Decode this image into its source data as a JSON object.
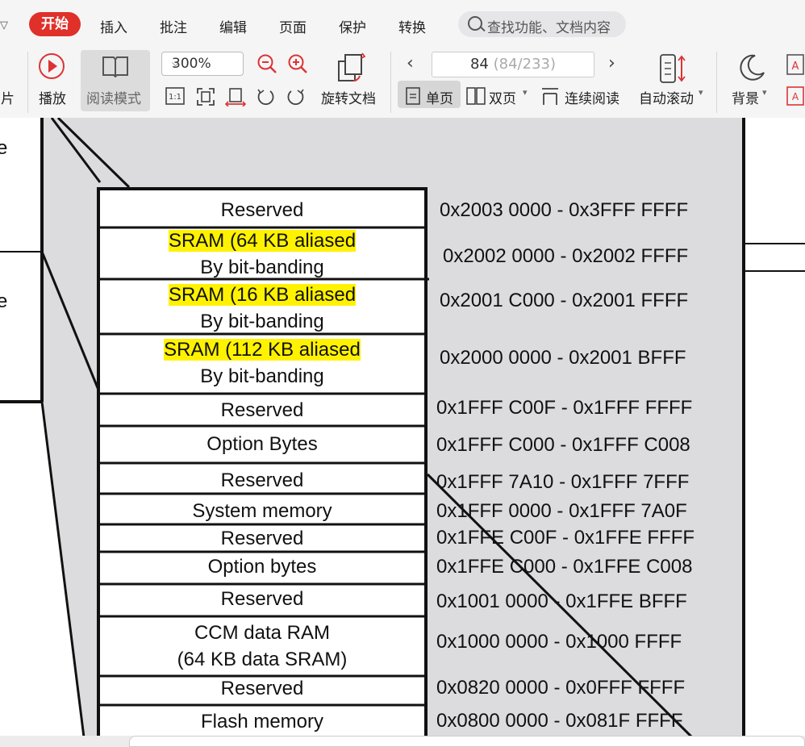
{
  "menu": {
    "active": "开始",
    "items": [
      "插入",
      "批注",
      "编辑",
      "页面",
      "保护",
      "转换"
    ],
    "search_placeholder": "查找功能、文档内容"
  },
  "toolbar": {
    "partial_left_label": "图片",
    "play": "播放",
    "read_mode": "阅读模式",
    "zoom": "300%",
    "rotate": "旋转文档",
    "page_current": "84",
    "page_total": "(84/233)",
    "single_page": "单页",
    "double_page": "双页",
    "continuous": "连续阅读",
    "auto_scroll": "自动滚动",
    "background": "背景"
  },
  "document": {
    "edge_letters": [
      "e",
      "e"
    ],
    "rows": [
      {
        "label": "Reserved",
        "address": "0x2003 0000 - 0x3FFF FFFF"
      },
      {
        "label_line1": "SRAM (64 KB aliased",
        "label_line2": "By bit-banding",
        "address": "0x2002 0000 - 0x2002 FFFF"
      },
      {
        "label_line1": "SRAM (16 KB aliased",
        "label_line2": "By bit-banding",
        "address": "0x2001 C000 - 0x2001 FFFF"
      },
      {
        "label_line1": "SRAM (112 KB aliased",
        "label_line2": "By bit-banding",
        "address": "0x2000 0000 - 0x2001 BFFF"
      },
      {
        "label": "Reserved",
        "address": "0x1FFF C00F - 0x1FFF FFFF"
      },
      {
        "label": "Option Bytes",
        "address": "0x1FFF C000 - 0x1FFF C008"
      },
      {
        "label": "Reserved",
        "address": "0x1FFF 7A10 - 0x1FFF 7FFF"
      },
      {
        "label": "System memory",
        "address": "0x1FFF 0000 - 0x1FFF 7A0F"
      },
      {
        "label": "Reserved",
        "address": "0x1FFE C00F - 0x1FFE FFFF"
      },
      {
        "label": "Option bytes",
        "address": "0x1FFE C000 - 0x1FFE C008"
      },
      {
        "label": "Reserved",
        "address": "0x1001 0000 - 0x1FFE BFFF"
      },
      {
        "label_line1": "CCM data RAM",
        "label_line2": "(64 KB data SRAM)",
        "address": "0x1000 0000 - 0x1000 FFFF"
      },
      {
        "label": "Reserved",
        "address": "0x0820 0000 - 0x0FFF FFFF"
      },
      {
        "label": "Flash memory",
        "address": "0x0800 0000 - 0x081F FFFF"
      }
    ]
  },
  "colors": {
    "accent": "#e0302a",
    "highlight": "#fff200",
    "diagram_fill": "#dcdcdf"
  }
}
